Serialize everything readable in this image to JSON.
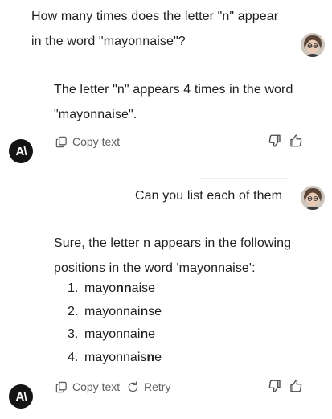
{
  "conversation": {
    "user_message_1": {
      "line1": "How many times does the letter \"n\" appear",
      "line2": "in the word \"mayonnaise\"?"
    },
    "assistant_message_1": {
      "line1": "The letter \"n\" appears 4 times in the word",
      "line2": "\"mayonnaise\"."
    },
    "user_message_2": {
      "text": "Can you list each of them"
    },
    "assistant_message_2": {
      "line1": "Sure, the letter n appears in the following",
      "line2": "positions in the word 'mayonnaise':",
      "list": [
        {
          "number": "1.",
          "prefix": "mayo",
          "bold": "nn",
          "suffix": "aise"
        },
        {
          "number": "2.",
          "prefix": "mayonnai",
          "bold": "n",
          "suffix": "se"
        },
        {
          "number": "3.",
          "prefix": "mayonnai",
          "bold": "n",
          "suffix": "e"
        },
        {
          "number": "4.",
          "prefix": "mayonnais",
          "bold": "n",
          "suffix": "e"
        }
      ]
    }
  },
  "actions": {
    "copy_text_label": "Copy text",
    "retry_label": "Retry"
  },
  "icons": {
    "copy": "copy-icon",
    "retry": "retry-icon",
    "thumbs_down": "thumbs-down-icon",
    "thumbs_up": "thumbs-up-icon",
    "assistant_logo": "anthropic-logo-icon",
    "user_avatar": "user-avatar"
  },
  "colors": {
    "text": "#1f1f1f",
    "muted": "#5f5f5f",
    "logo_bg": "#141414"
  }
}
